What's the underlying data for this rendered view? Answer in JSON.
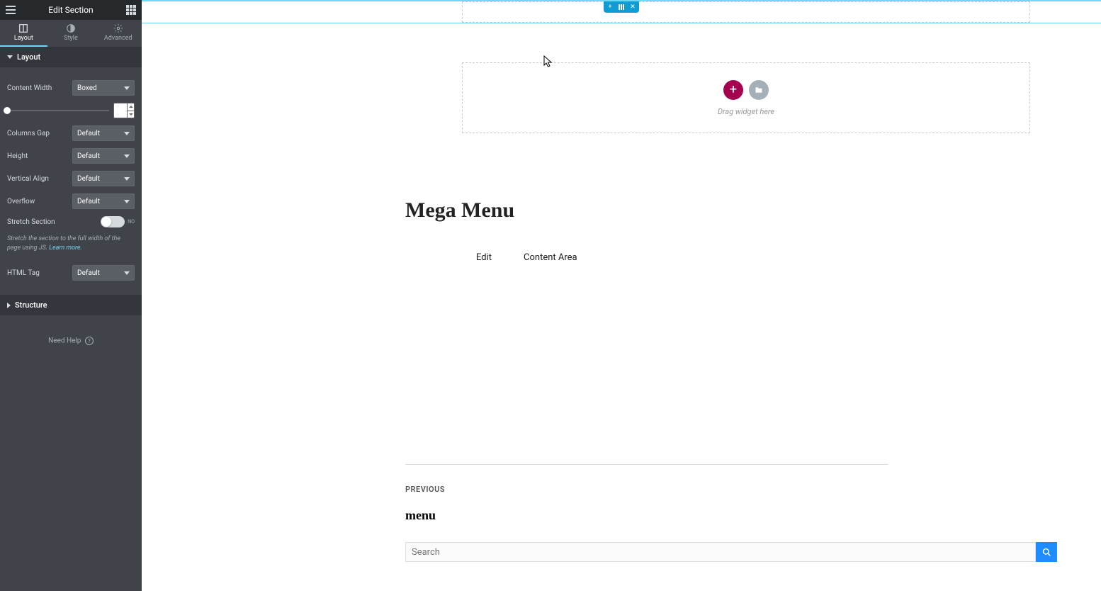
{
  "header": {
    "title": "Edit Section"
  },
  "tabs": {
    "layout": "Layout",
    "style": "Style",
    "advanced": "Advanced"
  },
  "panel": {
    "layout_section": "Layout",
    "content_width_label": "Content Width",
    "content_width_value": "Boxed",
    "columns_gap_label": "Columns Gap",
    "columns_gap_value": "Default",
    "height_label": "Height",
    "height_value": "Default",
    "vertical_align_label": "Vertical Align",
    "vertical_align_value": "Default",
    "overflow_label": "Overflow",
    "overflow_value": "Default",
    "stretch_label": "Stretch Section",
    "stretch_toggle_text": "NO",
    "stretch_hint_pre": "Stretch the section to the full width of the page using JS. ",
    "stretch_hint_link": "Learn more.",
    "html_tag_label": "HTML Tag",
    "html_tag_value": "Default",
    "structure_section": "Structure",
    "need_help": "Need Help",
    "need_help_q": "?"
  },
  "canvas": {
    "drag_text": "Drag widget here",
    "page_title": "Mega Menu",
    "edit_link": "Edit",
    "content_area": "Content Area",
    "prev_label": "PREVIOUS",
    "prev_title": "menu",
    "search_placeholder": "Search"
  }
}
